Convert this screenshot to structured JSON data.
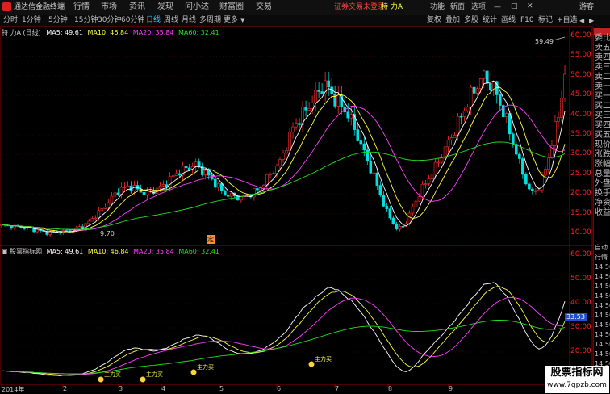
{
  "titlebar": {
    "app_name": "通达信金融终端",
    "menu": [
      "行情",
      "市场",
      "资讯",
      "发现",
      "问小达",
      "财富圈",
      "交易"
    ],
    "login_status": "证券交易未登录",
    "stock_name": "特 力A",
    "right_menu": [
      "功能",
      "新面",
      "选项",
      "游客"
    ]
  },
  "toolbar": {
    "periods": [
      "分时",
      "1分钟",
      "5分钟",
      "15分钟",
      "30分钟",
      "60分钟",
      "日线",
      "周线",
      "月线",
      "多周期",
      "更多"
    ],
    "active_period": "日线",
    "tools": [
      "复权",
      "叠加",
      "多股",
      "统计",
      "画线",
      "F10",
      "标记",
      "+自选"
    ]
  },
  "main_chart": {
    "title": "特 力A (日线)",
    "ma5_label": "MA5: 49.61",
    "ma10_label": "MA10: 46.84",
    "ma20_label": "MA20: 35.84",
    "ma60_label": "MA60: 32.41",
    "high_label": "59.49",
    "low_label": "9.70",
    "marker_label": "定",
    "y_ticks": [
      "60.00",
      "55.00",
      "50.00",
      "45.00",
      "40.00",
      "35.00",
      "30.00",
      "25.00",
      "20.00",
      "15.00",
      "10.00"
    ]
  },
  "sub_chart": {
    "title": "股票指标网",
    "ma5_label": "MA5: 49.61",
    "ma10_label": "MA10: 46.84",
    "ma20_label": "MA20: 35.84",
    "ma60_label": "MA60: 32.41",
    "y_ticks": [
      "60.00",
      "50.00",
      "40.00",
      "30.00",
      "20.00"
    ],
    "current_value": "33.53",
    "signal_labels": [
      "主力买",
      "主力买",
      "主力买",
      "主力买"
    ]
  },
  "x_axis": {
    "labels": [
      "2014年",
      "2",
      "3",
      "4",
      "5",
      "6",
      "7",
      "8",
      "9"
    ]
  },
  "side_panel": {
    "items": [
      "委比",
      "卖五",
      "卖四",
      "卖三",
      "卖二",
      "卖一",
      "买一",
      "买二",
      "买三",
      "买四",
      "买五",
      "现价",
      "涨跌",
      "涨幅",
      "总量",
      "外盘",
      "换手",
      "净资",
      "收益"
    ],
    "bottom_items": [
      "自动",
      "行情",
      "14:50",
      "14:50",
      "14:50",
      "14:50",
      "14:50",
      "14:50",
      "14:50",
      "14:50",
      "14:50",
      "14:50",
      "14:50"
    ]
  },
  "watermark": {
    "line1": "股票指标网",
    "line2": "www.7gpzb.com"
  },
  "colors": {
    "up": "#ff3030",
    "down": "#00e0e0",
    "ma5": "#ffffff",
    "ma10": "#ffff40",
    "ma20": "#ff40ff",
    "ma60": "#20e020",
    "axis": "#ff2020"
  }
}
